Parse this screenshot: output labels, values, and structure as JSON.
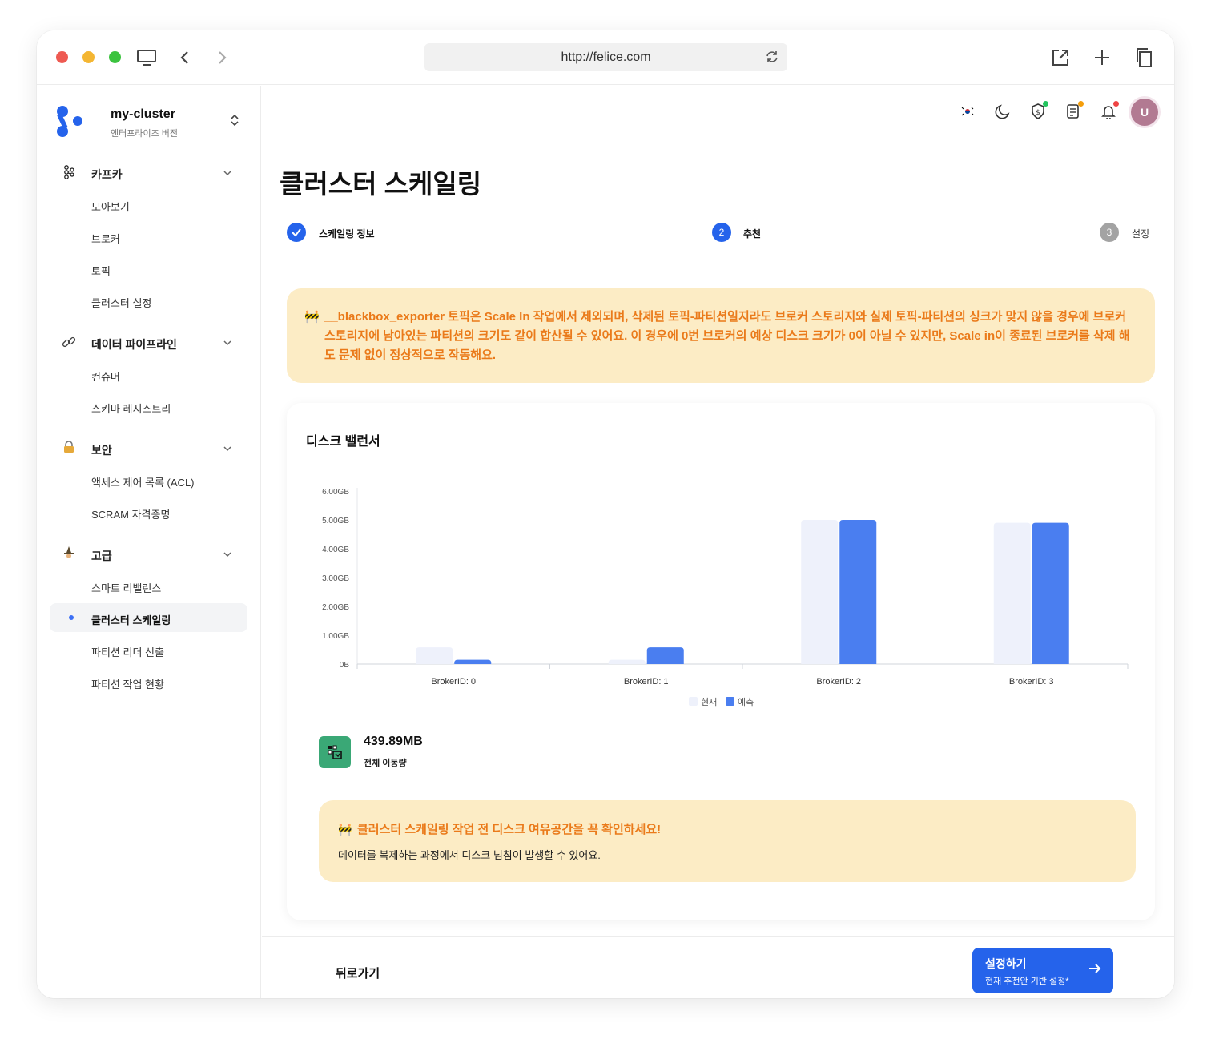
{
  "browser": {
    "url": "http://felice.com"
  },
  "sidebar": {
    "cluster_name": "my-cluster",
    "cluster_edition": "엔터프라이즈 버전",
    "groups": [
      {
        "label": "카프카",
        "icon": "kafka-icon",
        "items": [
          "모아보기",
          "브로커",
          "토픽",
          "클러스터 설정"
        ]
      },
      {
        "label": "데이터 파이프라인",
        "icon": "link-icon",
        "items": [
          "컨슈머",
          "스키마 레지스트리"
        ]
      },
      {
        "label": "보안",
        "icon": "lock-icon",
        "items": [
          "액세스 제어 목록 (ACL)",
          "SCRAM 자격증명"
        ]
      },
      {
        "label": "고급",
        "icon": "wizard-icon",
        "items": [
          "스마트 리밸런스",
          "클러스터 스케일링",
          "파티션 리더 선출",
          "파티션 작업 현황"
        ]
      }
    ],
    "active_item": "클러스터 스케일링"
  },
  "topbar": {
    "avatar_initial": "U",
    "badge_colors": {
      "shield": "#22c55e",
      "docs": "#f59e0b",
      "bell": "#ef4444"
    }
  },
  "page": {
    "title": "클러스터 스케일링",
    "steps": [
      {
        "label": "스케일링 정보",
        "state": "done",
        "number": "1"
      },
      {
        "label": "추천",
        "state": "current",
        "number": "2"
      },
      {
        "label": "설정",
        "state": "pending",
        "number": "3"
      }
    ],
    "warning_icon": "🚧",
    "warning_text": "__blackbox_exporter 토픽은 Scale In 작업에서 제외되며, 삭제된 토픽-파티션일지라도 브로커 스토리지와 실제 토픽-파티션의 싱크가 맞지 않을 경우에 브로커 스토리지에 남아있는 파티션의 크기도 같이 합산될 수 있어요. 이 경우에 0번 브로커의 예상 디스크 크기가 0이 아닐 수 있지만, Scale in이 종료된 브로커를 삭제 해도 문제 없이 정상적으로 작동해요."
  },
  "card": {
    "title": "디스크 밸런서",
    "metric_value": "439.89MB",
    "metric_label": "전체 이동량",
    "note_icon": "🚧",
    "note_title": "클러스터 스케일링 작업 전 디스크 여유공간을 꼭 확인하세요!",
    "note_body": "데이터를 복제하는 과정에서 디스크 넘침이 발생할 수 있어요."
  },
  "chart_data": {
    "type": "bar",
    "categories": [
      "BrokerID: 0",
      "BrokerID: 1",
      "BrokerID: 2",
      "BrokerID: 3"
    ],
    "series": [
      {
        "name": "현재",
        "values": [
          0.58,
          0.15,
          5.0,
          4.9
        ],
        "color": "#eef1fb"
      },
      {
        "name": "예측",
        "values": [
          0.15,
          0.58,
          5.0,
          4.9
        ],
        "color": "#4a7ef0"
      }
    ],
    "yticks": [
      "0B",
      "1.00GB",
      "2.00GB",
      "3.00GB",
      "4.00GB",
      "5.00GB",
      "6.00GB"
    ],
    "ylim": [
      0,
      6
    ],
    "unit": "GB",
    "legend_position": "bottom-center"
  },
  "footer": {
    "back_label": "뒤로가기",
    "primary_label": "설정하기",
    "primary_sub": "현재 추천안 기반 설정*"
  }
}
